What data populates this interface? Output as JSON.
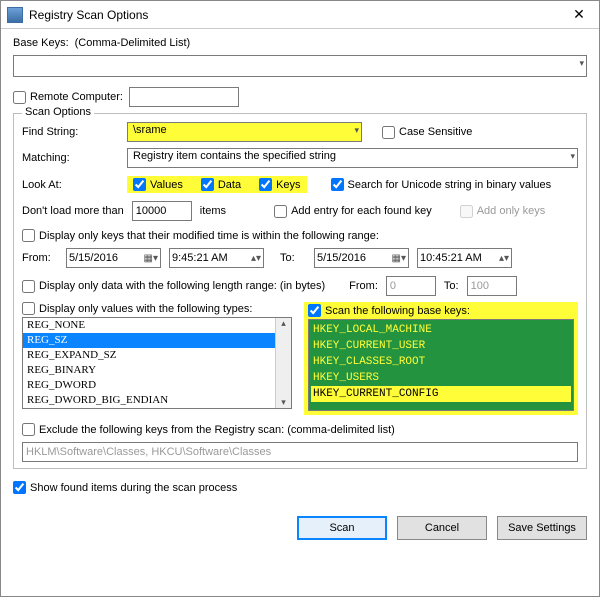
{
  "window": {
    "title": "Registry Scan Options"
  },
  "baseKeys": {
    "label": "Base Keys:",
    "hint": "(Comma-Delimited List)",
    "value": ""
  },
  "remoteComputer": {
    "label": "Remote Computer:",
    "checked": false,
    "value": ""
  },
  "scanOptions": {
    "legend": "Scan Options",
    "findString": {
      "label": "Find String:",
      "value": "\\srame"
    },
    "caseSensitive": {
      "label": "Case Sensitive",
      "checked": false
    },
    "matching": {
      "label": "Matching:",
      "value": "Registry item contains the specified string"
    },
    "lookAt": {
      "label": "Look At:",
      "values": {
        "label": "Values",
        "checked": true
      },
      "data": {
        "label": "Data",
        "checked": true
      },
      "keys": {
        "label": "Keys",
        "checked": true
      }
    },
    "unicodeSearch": {
      "label": "Search for Unicode string in binary values",
      "checked": true
    },
    "dontLoad": {
      "prefix": "Don't load more than",
      "value": "10000",
      "suffix": "items"
    },
    "addEntry": {
      "label": "Add entry for each found key",
      "checked": false
    },
    "addOnlyKeys": {
      "label": "Add only keys",
      "checked": false
    },
    "timeRange": {
      "label": "Display only keys that their modified time is within the following range:",
      "checked": false,
      "fromLabel": "From:",
      "toLabel": "To:",
      "fromDate": "5/15/2016",
      "fromTime": "9:45:21 AM",
      "toDate": "5/15/2016",
      "toTime": "10:45:21 AM"
    },
    "lengthRange": {
      "label": "Display only data with the following length range: (in bytes)",
      "checked": false,
      "fromLabel": "From:",
      "toLabel": "To:",
      "fromVal": "0",
      "toVal": "100"
    },
    "typeFilter": {
      "label": "Display only values with the following types:",
      "checked": false,
      "items": [
        "REG_NONE",
        "REG_SZ",
        "REG_EXPAND_SZ",
        "REG_BINARY",
        "REG_DWORD",
        "REG_DWORD_BIG_ENDIAN"
      ],
      "selectedIndex": 1
    },
    "scanBaseKeys": {
      "label": "Scan the following base keys:",
      "checked": true,
      "items": [
        "HKEY_LOCAL_MACHINE",
        "HKEY_CURRENT_USER",
        "HKEY_CLASSES_ROOT",
        "HKEY_USERS",
        "HKEY_CURRENT_CONFIG"
      ],
      "yellowIndex": 4
    },
    "exclude": {
      "label": "Exclude the following keys from the Registry scan: (comma-delimited list)",
      "checked": false,
      "placeholder": "HKLM\\Software\\Classes, HKCU\\Software\\Classes"
    }
  },
  "showFound": {
    "label": "Show found items during the scan process",
    "checked": true
  },
  "buttons": {
    "scan": "Scan",
    "cancel": "Cancel",
    "save": "Save Settings"
  }
}
